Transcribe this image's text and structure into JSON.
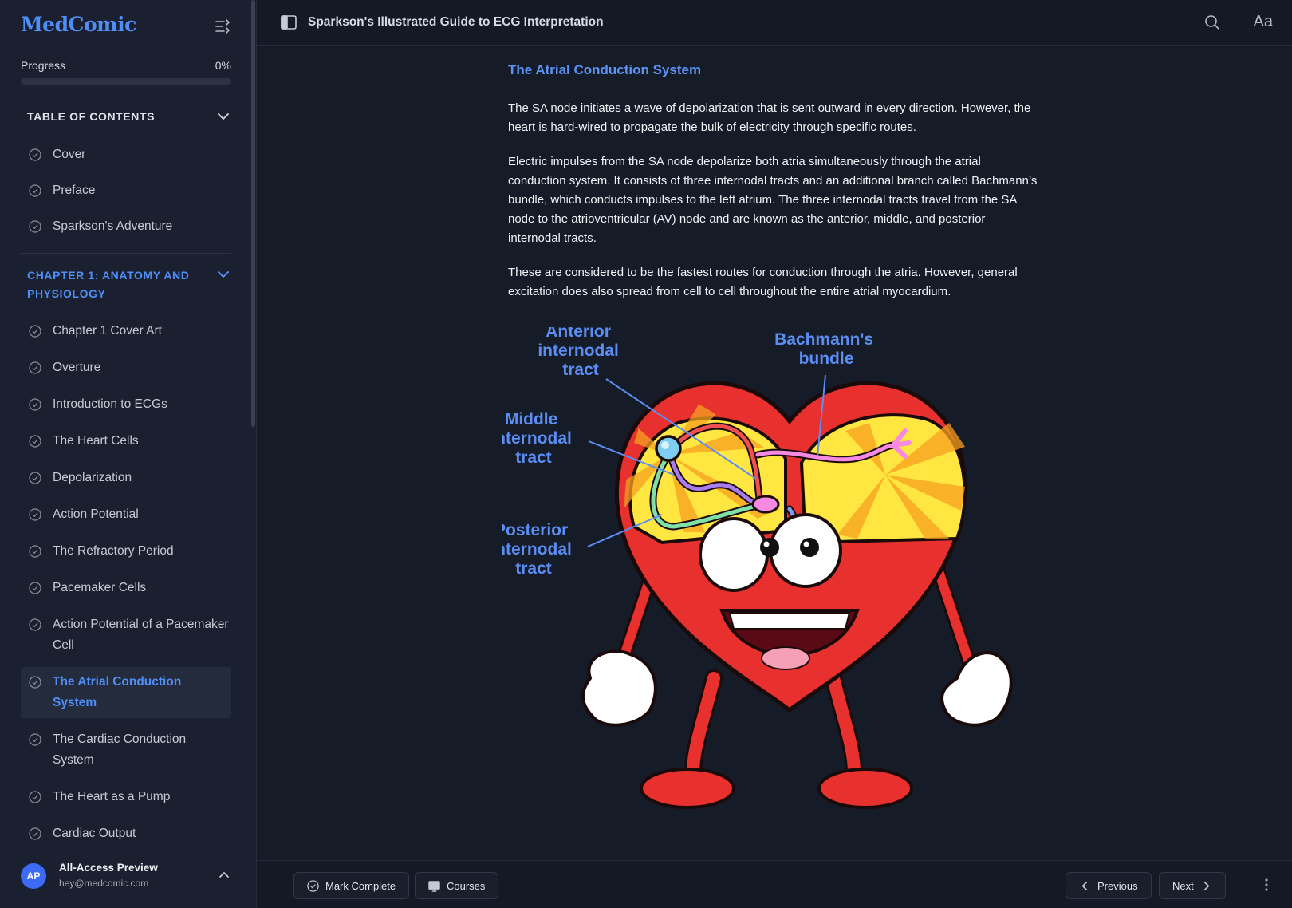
{
  "app": {
    "logo": "MedComic",
    "book_title": "Sparkson's Illustrated Guide to ECG Interpretation"
  },
  "progress": {
    "label": "Progress",
    "percent_text": "0%",
    "value": 0
  },
  "toc": {
    "heading": "TABLE OF CONTENTS",
    "items": [
      {
        "label": "Cover"
      },
      {
        "label": "Preface"
      },
      {
        "label": "Sparkson's Adventure"
      }
    ]
  },
  "chapter1": {
    "heading": "CHAPTER 1: ANATOMY AND PHYSIOLOGY",
    "items": [
      {
        "label": "Chapter 1 Cover Art"
      },
      {
        "label": "Overture"
      },
      {
        "label": "Introduction to ECGs"
      },
      {
        "label": "The Heart Cells"
      },
      {
        "label": "Depolarization"
      },
      {
        "label": "Action Potential"
      },
      {
        "label": "The Refractory Period"
      },
      {
        "label": "Pacemaker Cells"
      },
      {
        "label": "Action Potential of a Pacemaker Cell"
      },
      {
        "label": "The Atrial Conduction System",
        "active": true
      },
      {
        "label": "The Cardiac Conduction System"
      },
      {
        "label": "The Heart as a Pump"
      },
      {
        "label": "Cardiac Output"
      }
    ]
  },
  "user": {
    "initials": "AP",
    "name": "All-Access Preview",
    "email": "hey@medcomic.com"
  },
  "content": {
    "title": "The Atrial Conduction System",
    "paragraphs": [
      "The SA node initiates a wave of depolarization that is sent outward in every direction. However, the heart is hard-wired to propagate the bulk of electricity through specific routes.",
      "Electric impulses from the SA node depolarize both atria simultaneously through the atrial conduction system. It consists of three internodal tracts and an additional branch called Bachmann’s bundle, which conducts impulses to the left atrium. The three internodal tracts travel from the SA node to the atrioventricular (AV) node and are known as the anterior, middle, and posterior internodal tracts.",
      "These are considered to be the fastest routes for conduction through the atria. However, general excitation does also spread from cell to cell throughout the entire atrial myocardium."
    ],
    "figure_labels": {
      "anterior": [
        "Anterior",
        "internodal",
        "tract"
      ],
      "bachmann": [
        "Bachmann's",
        "bundle"
      ],
      "middle": [
        "Middle",
        "internodal",
        "tract"
      ],
      "posterior": [
        "Posterior",
        "internodal",
        "tract"
      ]
    }
  },
  "footer": {
    "mark_complete": "Mark Complete",
    "courses": "Courses",
    "previous": "Previous",
    "next": "Next"
  },
  "colors": {
    "accent": "#4f8ef7",
    "label_blue": "#5b8ef5",
    "heart_red": "#e8312e",
    "background": "#161b28"
  }
}
